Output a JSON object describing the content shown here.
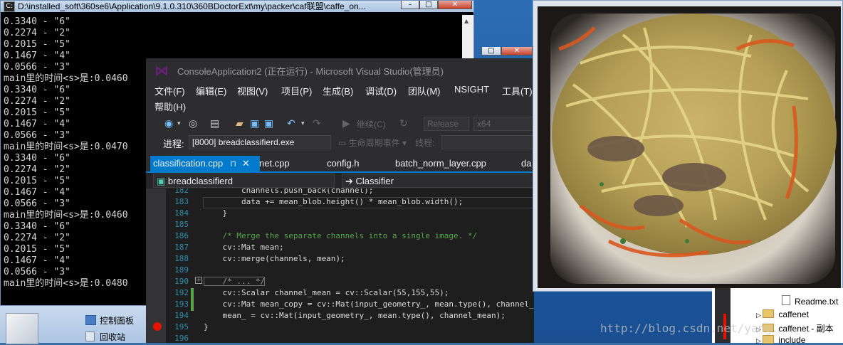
{
  "console": {
    "title": "D:\\installed_soft\\360se6\\Application\\9.1.0.310\\360BDoctorExt\\my\\packer\\caf联盟\\caffe_on...",
    "lines": [
      "0.3340 - \"6\"",
      "0.2274 - \"2\"",
      "0.2015 - \"5\"",
      "0.1467 - \"4\"",
      "0.0566 - \"3\"",
      "main里的时间<s>是:0.0460",
      "0.3340 - \"6\"",
      "0.2274 - \"2\"",
      "0.2015 - \"5\"",
      "0.1467 - \"4\"",
      "0.0566 - \"3\"",
      "main里的时间<s>是:0.0470",
      "0.3340 - \"6\"",
      "0.2274 - \"2\"",
      "0.2015 - \"5\"",
      "0.1467 - \"4\"",
      "0.0566 - \"3\"",
      "main里的时间<s>是:0.0460",
      "0.3340 - \"6\"",
      "0.2274 - \"2\"",
      "0.2015 - \"5\"",
      "0.1467 - \"4\"",
      "0.0566 - \"3\"",
      "main里的时间<s>是:0.0480"
    ]
  },
  "quick_launch": {
    "control_panel": "控制面板",
    "recycle_bin": "回收站"
  },
  "vs": {
    "title": "ConsoleApplication2 (正在运行) - Microsoft Visual Studio(管理员)",
    "menu": [
      "文件(F)",
      "编辑(E)",
      "视图(V)",
      "项目(P)",
      "生成(B)",
      "调试(D)",
      "团队(M)",
      "NSIGHT",
      "工具(T)",
      "帮助(H)"
    ],
    "toolbar": {
      "continue_label": "继续(C)",
      "config": "Release",
      "platform": "x64"
    },
    "debug_bar": {
      "process_label": "进程:",
      "process_value": "[8000] breadclassifierd.exe",
      "lifecycle_label": "生命周期事件",
      "thread_label": "线程:"
    },
    "tabs": [
      "classification.cpp",
      "net.cpp",
      "config.h",
      "batch_norm_layer.cpp",
      "da"
    ],
    "active_tab_pin": "⊓",
    "active_tab_close": "✕",
    "nav": {
      "project": "breadclassifierd",
      "scope": "Classifier"
    },
    "code": [
      {
        "n": "182",
        "text": "        channels.push_back(channel);"
      },
      {
        "n": "183",
        "text": "        data += mean_blob.height() * mean_blob.width();"
      },
      {
        "n": "184",
        "text": "    }"
      },
      {
        "n": "185",
        "text": ""
      },
      {
        "n": "186",
        "text": "    /* Merge the separate channels into a single image. */"
      },
      {
        "n": "187",
        "text": "    cv::Mat mean;"
      },
      {
        "n": "188",
        "text": "    cv::merge(channels, mean);"
      },
      {
        "n": "189",
        "text": ""
      },
      {
        "n": "190",
        "text": "    /* ... */"
      },
      {
        "n": "192",
        "text": "    cv::Scalar channel_mean = cv::Scalar(55,155,55);"
      },
      {
        "n": "193",
        "text": "    cv::Mat mean_copy = cv::Mat(input_geometry_, mean.type(), channel_mean);"
      },
      {
        "n": "194",
        "text": "    mean_ = cv::Mat(input_geometry_, mean.type(), channel_mean);"
      },
      {
        "n": "195",
        "text": "}"
      },
      {
        "n": "196",
        "text": ""
      }
    ]
  },
  "explorer": {
    "items": [
      "Readme.txt",
      "caffenet",
      "caffenet - 副本",
      "include"
    ]
  },
  "watermark": "http://blog.csdn.net/yang......"
}
